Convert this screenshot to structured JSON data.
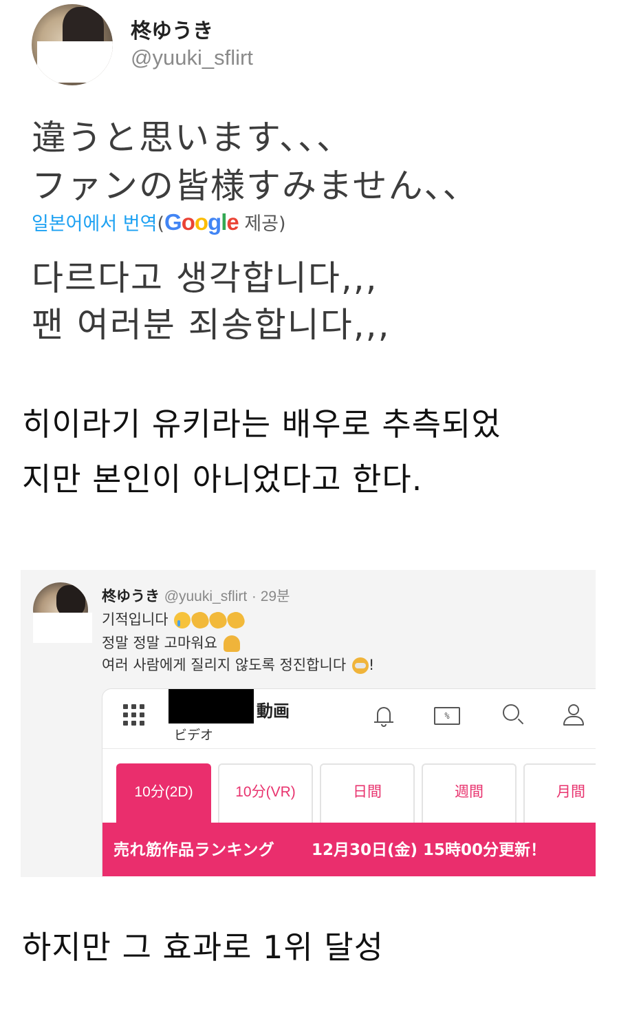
{
  "tweet1": {
    "display_name": "柊ゆうき",
    "handle": "@yuuki_sflirt",
    "jp_line1": "違うと思います、、、",
    "jp_line2": "ファンの皆様すみません、、",
    "translate_label": "일본어에서 번역",
    "translate_provider_prefix": "(",
    "google": "Google",
    "translate_provided": " 제공)",
    "kr_line1": "다르다고 생각합니다,,,",
    "kr_line2": "팬 여러분 죄송합니다,,,"
  },
  "caption1": {
    "line1": "히이라기 유키라는 배우로 추측되었",
    "line2": "지만 본인이 아니었다고 한다."
  },
  "tweet2": {
    "display_name": "柊ゆうき",
    "handle": "@yuuki_sflirt",
    "time": "· 29분",
    "line1": "기적입니다",
    "line2": "정말 정말 고마워요",
    "line3": "여러 사람에게 질리지 않도록 정진합니다",
    "line3_end": "!",
    "card": {
      "title": "動画",
      "subtitle": "ビデオ",
      "coupon_icon_label": "%",
      "tabs": [
        "10分(2D)",
        "10分(VR)",
        "日間",
        "週間",
        "月間"
      ],
      "active_tab": 0,
      "ranking_title": "売れ筋作品ランキング",
      "ranking_update": "12月30日(金) 15時00分更新！"
    }
  },
  "caption2": "하지만 그 효과로 1위 달성",
  "colors": {
    "accent_pink": "#ea2e6d",
    "link_blue": "#1da1f2"
  },
  "icons": [
    "grid-menu-icon",
    "bell-icon",
    "coupon-icon",
    "search-icon",
    "user-icon"
  ]
}
